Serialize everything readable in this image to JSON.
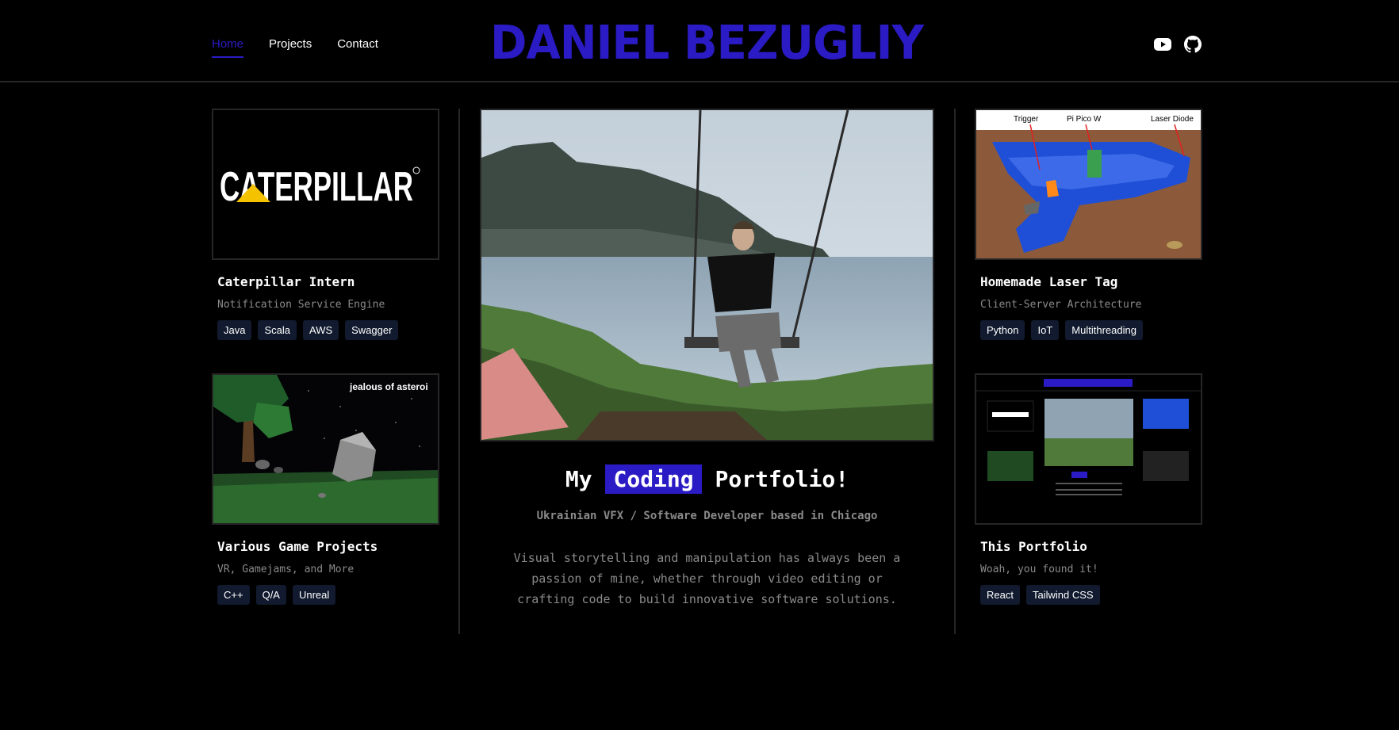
{
  "nav": {
    "items": [
      {
        "label": "Home",
        "active": true
      },
      {
        "label": "Projects",
        "active": false
      },
      {
        "label": "Contact",
        "active": false
      }
    ]
  },
  "brand": {
    "title": "DANIEL BEZUGLIY"
  },
  "social": [
    {
      "icon": "youtube-icon"
    },
    {
      "icon": "github-icon"
    }
  ],
  "colors": {
    "accent": "#2a1bc4",
    "background": "#000000",
    "muted": "#8a8a8a",
    "tag_bg": "#111a2e",
    "border": "#262626"
  },
  "projects": {
    "caterpillar": {
      "logo_text": "CATERPILLAR",
      "title": "Caterpillar Intern",
      "subtitle": "Notification Service Engine",
      "tags": [
        "Java",
        "Scala",
        "AWS",
        "Swagger"
      ]
    },
    "games": {
      "overlay_text": "jealous of asteroi",
      "title": "Various Game Projects",
      "subtitle": "VR, Gamejams, and More",
      "tags": [
        "C++",
        "Q/A",
        "Unreal"
      ]
    },
    "lasertag": {
      "annotations": [
        "Trigger",
        "Pi Pico W",
        "Laser Diode"
      ],
      "title": "Homemade Laser Tag",
      "subtitle": "Client-Server Architecture",
      "tags": [
        "Python",
        "IoT",
        "Multithreading"
      ]
    },
    "portfolio": {
      "title": "This Portfolio",
      "subtitle": "Woah, you found it!",
      "tags": [
        "React",
        "Tailwind CSS"
      ]
    }
  },
  "hero": {
    "title_prefix": "My",
    "title_highlight": "Coding",
    "title_suffix": "Portfolio!",
    "subtitle": "Ukrainian VFX / Software Developer based in Chicago",
    "description": "Visual storytelling and manipulation has always been a passion of mine, whether through video editing or crafting code to build innovative software solutions."
  }
}
